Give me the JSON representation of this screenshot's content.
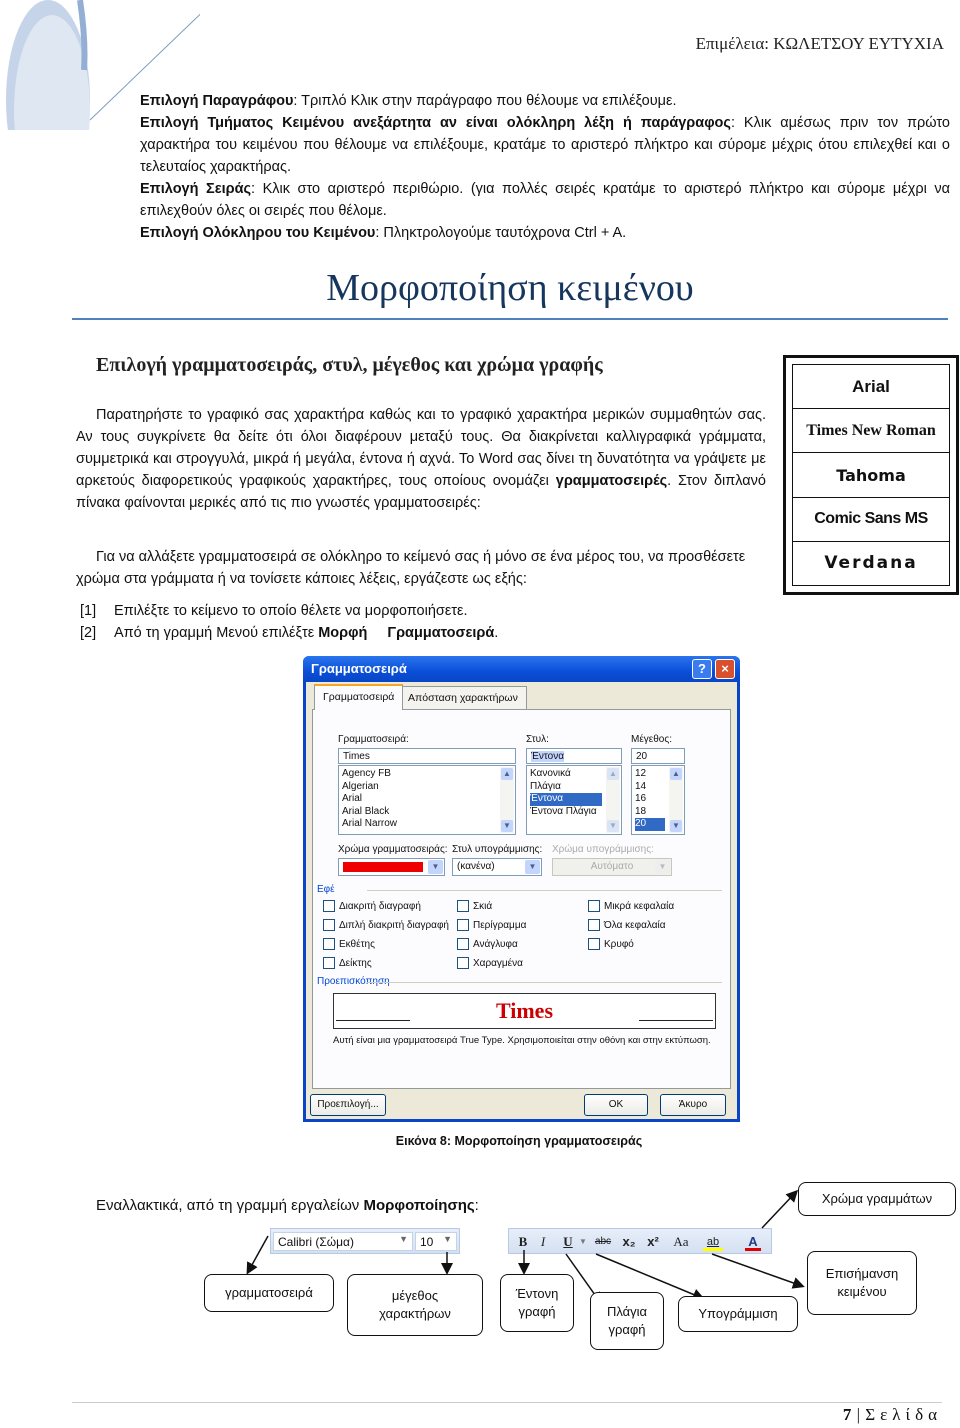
{
  "header": {
    "author": "Επιμέλεια: ΚΩΛΕΤΣΟΥ ΕΥΤΥΧΙΑ"
  },
  "selection_tips": [
    {
      "bold": "Επιλογή Παραγράφου",
      "text": ": Τριπλό Κλικ στην παράγραφο που θέλουμε να επιλέξουμε."
    },
    {
      "bold": "Επιλογή Τμήματος Κειμένου ανεξάρτητα αν είναι ολόκληρη λέξη ή παράγραφος",
      "text": ": Κλικ αμέσως πριν τον πρώτο χαρακτήρα του κειμένου που θέλουμε να επιλέξουμε, κρατάμε το αριστερό πλήκτρο και σύρομε μέχρις ότου επιλεχθεί και ο τελευταίος χαρακτήρας."
    },
    {
      "bold": "Επιλογή Σειράς",
      "text": ": Κλικ στο αριστερό περιθώριο. (για πολλές σειρές κρατάμε το αριστερό πλήκτρο και σύρομε μέχρι να επιλεχθούν όλες οι σειρές που θέλομε."
    },
    {
      "bold": "Επιλογή Ολόκληρου του Κειμένου",
      "text": ": Πληκτρολογούμε ταυτόχρονα Ctrl + A."
    }
  ],
  "section_title": "Μορφοποίηση κειμένου",
  "subsection_title": "Επιλογή γραμματοσειράς, στυλ, μέγεθος και χρώμα γραφής",
  "paragraph1": {
    "before": "Παρατηρήστε το γραφικό σας χαρακτήρα καθώς και το γραφικό χαρακτήρα μερικών συμμαθητών σας. Αν τους συγκρίνετε θα δείτε ότι όλοι διαφέρουν μεταξύ τους. Θα διακρίνεται καλλιγραφικά γράμματα, συμμετρικά και στρογγυλά, μικρά ή μεγάλα, έντονα ή αχνά. Το Word σας δίνει τη δυνατότητα να γράψετε με αρκετούς διαφορετικούς γραφικούς χαρακτήρες, τους οποίους ονομάζει ",
    "bold": "γραμματοσειρές",
    "after": ". Στον διπλανό πίνακα φαίνονται μερικές από τις πιο γνωστές γραμματοσειρές:"
  },
  "paragraph2": "Για να αλλάξετε γραμματοσειρά σε ολόκληρο το κείμενό σας ή μόνο σε ένα μέρος του, να προσθέσετε χρώμα στα γράμματα ή να τονίσετε κάποιες λέξεις, εργάζεστε ως εξής:",
  "steps": [
    {
      "num": "[1]",
      "text": "Επιλέξτε το κείμενο το οποίο θέλετε να μορφοποιήσετε.",
      "bold1": "",
      "bold2": ""
    },
    {
      "num": "[2]",
      "text": "Από τη γραμμή Μενού επιλέξτε ",
      "bold1": "Μορφή",
      "bold2": "Γραμματοσειρά",
      "tail": "."
    }
  ],
  "font_samples": [
    "Arial",
    "Times New Roman",
    "Tahoma",
    "Comic Sans MS",
    "Verdana"
  ],
  "dialog": {
    "title": "Γραμματοσειρά",
    "help": "?",
    "close": "×",
    "tabs": [
      "Γραμματοσειρά",
      "Απόσταση χαρακτήρων"
    ],
    "font_label": "Γραμματοσειρά:",
    "font_value": "Times",
    "font_list": [
      "Agency FB",
      "Algerian",
      "Arial",
      "Arial Black",
      "Arial Narrow"
    ],
    "style_label": "Στυλ:",
    "style_value": "Έντονα",
    "style_list": [
      "Κανονικά",
      "Πλάγια",
      "Έντονα",
      "Έντονα Πλάγια"
    ],
    "style_selected": "Έντονα",
    "size_label": "Μέγεθος:",
    "size_value": "20",
    "size_list": [
      "12",
      "14",
      "16",
      "18",
      "20"
    ],
    "size_selected": "20",
    "color_label": "Χρώμα γραμματοσειράς:",
    "color_value": "#ee0000",
    "underline_label": "Στυλ υπογράμμισης:",
    "underline_value": "(κανένα)",
    "underline_color_label": "Χρώμα υπογράμμισης:",
    "underline_color_value": "Αυτόματο",
    "effects_label": "Εφέ",
    "effects": [
      "Διακριτή διαγραφή",
      "Διπλή διακριτή διαγραφή",
      "Εκθέτης",
      "Δείκτης",
      "Σκιά",
      "Περίγραμμα",
      "Ανάγλυφα",
      "Χαραγμένα",
      "Μικρά κεφαλαία",
      "Όλα κεφαλαία",
      "Κρυφό"
    ],
    "preview_label": "Προεπισκόπηση",
    "preview_text": "Times",
    "preview_color": "#cc0000",
    "info": "Αυτή είναι μια γραμματοσειρά True Type. Χρησιμοποιείται στην οθόνη και στην εκτύπωση.",
    "default_button": "Προεπιλογή...",
    "ok_button": "OK",
    "cancel_button": "Άκυρο"
  },
  "figure_caption": "Εικόνα 8: Μορφοποίηση γραμματοσειράς",
  "alt_intro": {
    "text": "Εναλλακτικά, από τη γραμμή εργαλείων ",
    "bold": "Μορφοποίησης",
    "tail": ":"
  },
  "toolbar": {
    "font": "Calibri (Σώμα)",
    "size": "10",
    "bold": "B",
    "italic": "I",
    "underline": "U",
    "strike": "abc",
    "subscript": "x₂",
    "superscript": "x²",
    "change_case": "Aa",
    "highlight": "ab",
    "font_color": "A",
    "highlight_color": "#ffff00",
    "font_color_bar": "#e00000"
  },
  "callouts": {
    "font": "γραμματοσειρά",
    "size": "μέγεθος χαρακτήρων",
    "bold": "Έντονη γραφή",
    "italic": "Πλάγια γραφή",
    "underline": "Υπογράμμιση",
    "highlight": "Επισήμανση κειμένου",
    "color": "Χρώμα γραμμάτων"
  },
  "footer": {
    "page": "7",
    "sep": "|",
    "label": "Σελίδα"
  }
}
